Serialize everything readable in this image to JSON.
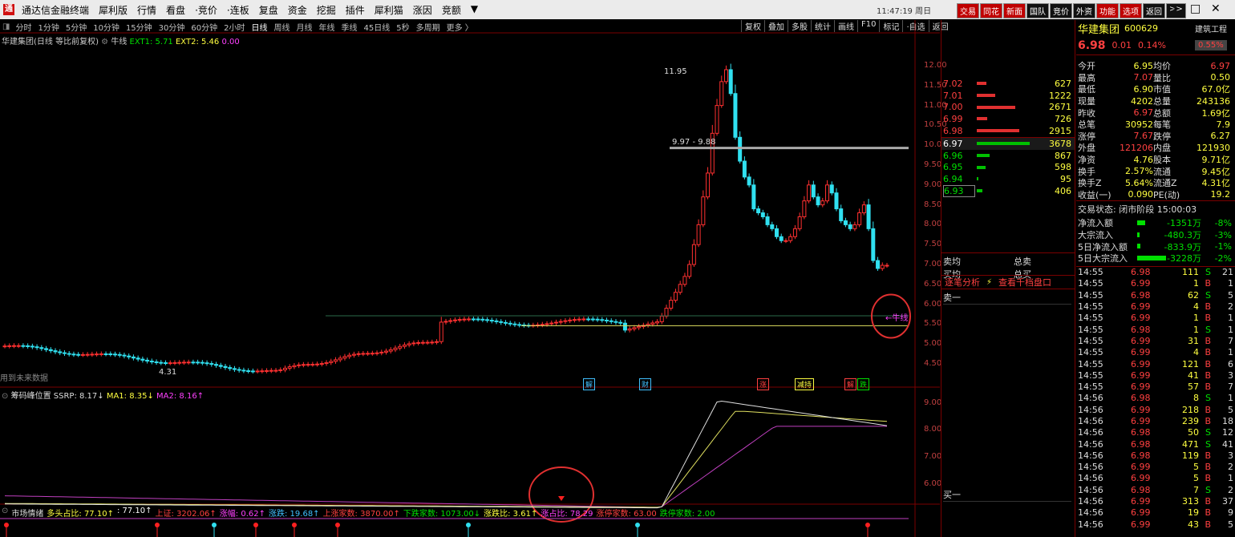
{
  "app": {
    "title": "通达信金融终端",
    "time": "11:47:19 周日"
  },
  "menu": [
    "犀利版",
    "行情",
    "看盘",
    "·竞价",
    "·连板",
    "复盘",
    "资金",
    "挖掘",
    "插件",
    "犀利猫",
    "涨因",
    "竞额",
    "▼"
  ],
  "toolbar_right": [
    {
      "label": "交易",
      "hl": true
    },
    {
      "label": "同花",
      "hl": true
    },
    {
      "label": "新面",
      "hl": true
    },
    {
      "label": "国队"
    },
    {
      "label": "竞价"
    },
    {
      "label": "外资"
    },
    {
      "label": "功能",
      "hl": true
    },
    {
      "label": "选项",
      "hl": true
    },
    {
      "label": "返回"
    },
    {
      "label": ">>"
    }
  ],
  "periods": [
    "分时",
    "1分钟",
    "5分钟",
    "10分钟",
    "15分钟",
    "30分钟",
    "60分钟",
    "2小时",
    "日线",
    "周线",
    "月线",
    "年线",
    "季线",
    "45日线",
    "5秒",
    "多周期",
    "更多 〉"
  ],
  "active_period": "日线",
  "period_tools": [
    "复权",
    "叠加",
    "多股",
    "统计",
    "画线",
    "F10",
    "标记",
    "·自选",
    "返回"
  ],
  "main_chart": {
    "title": "华建集团(日线 等比前复权)",
    "indicator": "牛线",
    "ext1": "EXT1: 5.71",
    "ext2": "EXT2: 5.46",
    "ext3": "0.00",
    "price_axis": [
      "12.00",
      "11.50",
      "11.00",
      "10.50",
      "10.00",
      "9.50",
      "9.00",
      "8.50",
      "8.00",
      "7.50",
      "7.00",
      "6.50",
      "6.00",
      "5.50",
      "5.00",
      "4.50"
    ],
    "peak_label": "11.95",
    "range_label": "9.97 - 9.88",
    "low_label": "4.31",
    "niu_label": "←牛线",
    "note": "用到未来数据",
    "signals": [
      {
        "t": "解",
        "c": "#40c0ff"
      },
      {
        "t": "财",
        "c": "#40c0ff"
      },
      {
        "t": "涨",
        "c": "#ff4040"
      },
      {
        "t": "减持",
        "c": "#ffff40"
      },
      {
        "t": "解",
        "c": "#ff4040"
      },
      {
        "t": "跌",
        "c": "#00e000"
      }
    ]
  },
  "sub_chart": {
    "title": "筹码峰位置",
    "ssrp": "SSRP: 8.17↓",
    "ma1": "MA1: 8.35↓",
    "ma2": "MA2: 8.16↑",
    "axis": [
      "9.00",
      "8.00",
      "7.00",
      "6.00"
    ]
  },
  "bottom_bar": {
    "label": "市场情绪",
    "items": [
      {
        "t": "多头占比: 77.10↑",
        "c": "#ffff40"
      },
      {
        "t": ": 77.10↑",
        "c": "#fff"
      },
      {
        "t": "上证: 3202.06↑",
        "c": "#ff4040"
      },
      {
        "t": "涨幅: 0.62↑",
        "c": "#ff40ff"
      },
      {
        "t": "涨跌: 19.68↑",
        "c": "#40c0ff"
      },
      {
        "t": "上涨家数: 3870.00↑",
        "c": "#ff4040"
      },
      {
        "t": "下跌家数: 1073.00↓",
        "c": "#00e000"
      },
      {
        "t": "涨跌比: 3.61↑",
        "c": "#ffff40"
      },
      {
        "t": "涨占比: 78.29",
        "c": "#ff40ff"
      },
      {
        "t": "涨停家数: 63.00",
        "c": "#ff4040"
      },
      {
        "t": "跌停家数: 2.00",
        "c": "#00e000"
      }
    ]
  },
  "stock": {
    "name": "华建集团",
    "code": "600629",
    "sector": "建筑工程",
    "price": "6.98",
    "change": "0.01",
    "pct": "0.14%",
    "pct_box": "0.55%"
  },
  "orderbook": {
    "asks": [
      {
        "p": "7.02",
        "v": "627",
        "w": 20
      },
      {
        "p": "7.01",
        "v": "1222",
        "w": 38
      },
      {
        "p": "7.00",
        "v": "2671",
        "w": 80
      },
      {
        "p": "6.99",
        "v": "726",
        "w": 22
      },
      {
        "p": "6.98",
        "v": "2915",
        "w": 88
      }
    ],
    "bids": [
      {
        "p": "6.97",
        "v": "3678",
        "w": 110
      },
      {
        "p": "6.96",
        "v": "867",
        "w": 26
      },
      {
        "p": "6.95",
        "v": "598",
        "w": 18
      },
      {
        "p": "6.94",
        "v": "95",
        "w": 3
      },
      {
        "p": "6.93",
        "v": "406",
        "w": 12
      }
    ]
  },
  "quote": [
    [
      "今开",
      "6.95",
      "均价",
      "6.97"
    ],
    [
      "最高",
      "7.07",
      "量比",
      "0.50"
    ],
    [
      "最低",
      "6.90",
      "市值",
      "67.0亿"
    ],
    [
      "现量",
      "4202",
      "总量",
      "243136"
    ],
    [
      "昨收",
      "6.97",
      "总额",
      "1.69亿"
    ],
    [
      "总笔",
      "30952",
      "每笔",
      "7.9"
    ],
    [
      "涨停",
      "7.67",
      "跌停",
      "6.27"
    ],
    [
      "外盘",
      "121206",
      "内盘",
      "121930"
    ],
    [
      "净资",
      "4.76",
      "股本",
      "9.71亿"
    ],
    [
      "换手",
      "2.57%",
      "流通",
      "9.45亿"
    ],
    [
      "换手Z",
      "5.64%",
      "流通Z",
      "4.31亿"
    ],
    [
      "收益(一)",
      "0.090",
      "PE(动)",
      "19.2"
    ]
  ],
  "trade_status": "交易状态: 闭市阶段 15:00:03",
  "flows": [
    {
      "k": "净流入额",
      "v": "-1351万",
      "p": "-8%"
    },
    {
      "k": "大宗流入",
      "v": "-480.3万",
      "p": "-3%"
    },
    {
      "k": "5日净流入额",
      "v": "-833.9万",
      "p": "-1%"
    },
    {
      "k": "5日大宗流入",
      "v": "-3228万",
      "p": "-2%"
    }
  ],
  "mid_labels": {
    "sell_avg": "卖均",
    "total_sell": "总卖",
    "buy_avg": "买均",
    "total_buy": "总买",
    "tick_analysis": "逐笔分析",
    "view_depth": "查看千档盘口",
    "sell1": "卖一",
    "buy1": "买一"
  },
  "ticks": [
    [
      "14:55",
      "6.98",
      "111",
      "S",
      "21"
    ],
    [
      "14:55",
      "6.99",
      "1",
      "B",
      "1"
    ],
    [
      "14:55",
      "6.98",
      "62",
      "S",
      "5"
    ],
    [
      "14:55",
      "6.99",
      "4",
      "B",
      "2"
    ],
    [
      "14:55",
      "6.99",
      "1",
      "B",
      "1"
    ],
    [
      "14:55",
      "6.98",
      "1",
      "S",
      "1"
    ],
    [
      "14:55",
      "6.99",
      "31",
      "B",
      "7"
    ],
    [
      "14:55",
      "6.99",
      "4",
      "B",
      "1"
    ],
    [
      "14:55",
      "6.99",
      "121",
      "B",
      "6"
    ],
    [
      "14:55",
      "6.99",
      "41",
      "B",
      "3"
    ],
    [
      "14:55",
      "6.99",
      "57",
      "B",
      "7"
    ],
    [
      "14:56",
      "6.98",
      "8",
      "S",
      "1"
    ],
    [
      "14:56",
      "6.99",
      "218",
      "B",
      "5"
    ],
    [
      "14:56",
      "6.99",
      "239",
      "B",
      "18"
    ],
    [
      "14:56",
      "6.98",
      "50",
      "S",
      "12"
    ],
    [
      "14:56",
      "6.98",
      "471",
      "S",
      "41"
    ],
    [
      "14:56",
      "6.98",
      "119",
      "B",
      "3"
    ],
    [
      "14:56",
      "6.99",
      "5",
      "B",
      "2"
    ],
    [
      "14:56",
      "6.99",
      "5",
      "B",
      "1"
    ],
    [
      "14:56",
      "6.98",
      "7",
      "S",
      "2"
    ],
    [
      "14:56",
      "6.99",
      "313",
      "B",
      "37"
    ],
    [
      "14:56",
      "6.99",
      "19",
      "B",
      "9"
    ],
    [
      "14:56",
      "6.99",
      "43",
      "B",
      "5"
    ]
  ]
}
